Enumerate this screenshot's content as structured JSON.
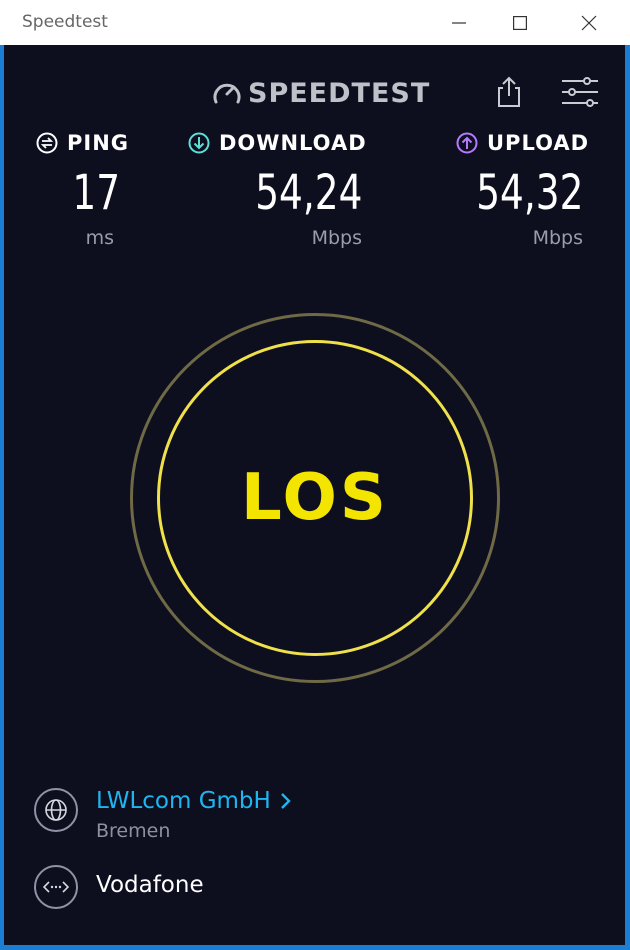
{
  "window": {
    "title": "Speedtest"
  },
  "header": {
    "brand": "SPEEDTEST",
    "share_icon": "share-icon",
    "settings_icon": "sliders-icon"
  },
  "metrics": {
    "ping": {
      "label": "PING",
      "value": "17",
      "unit": "ms",
      "icon": "ping-icon",
      "color": "#ffffff"
    },
    "download": {
      "label": "DOWNLOAD",
      "value": "54,24",
      "unit": "Mbps",
      "icon": "download-arrow-icon",
      "color": "#5ce0d6"
    },
    "upload": {
      "label": "UPLOAD",
      "value": "54,32",
      "unit": "Mbps",
      "icon": "upload-arrow-icon",
      "color": "#b57bff"
    }
  },
  "go_button": {
    "label": "LOS",
    "color": "#f4e500"
  },
  "server": {
    "name": "LWLcom GmbH",
    "location": "Bremen",
    "icon": "globe-icon"
  },
  "isp": {
    "name": "Vodafone",
    "icon": "connection-icon"
  }
}
